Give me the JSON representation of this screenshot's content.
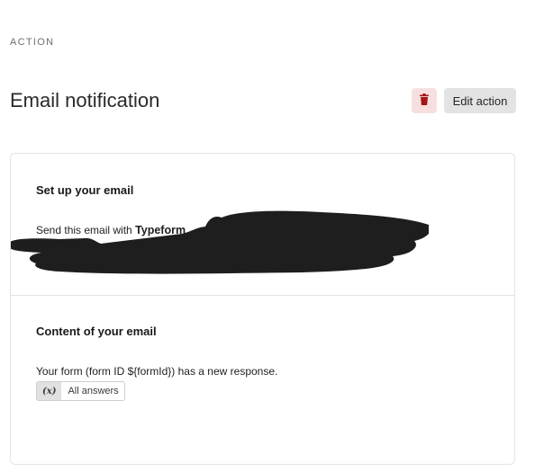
{
  "header": {
    "section_label": "ACTION",
    "title": "Email notification",
    "edit_label": "Edit action",
    "delete_icon": "trash-icon"
  },
  "setup": {
    "heading": "Set up your email",
    "sender_prefix": "Send this email with ",
    "sender_brand": "Typeform"
  },
  "content": {
    "heading": "Content of your email",
    "body": "Your form (form ID ${formId}) has a new response.",
    "variable_icon": "(x)",
    "variable_label": "All answers"
  },
  "colors": {
    "delete_bg": "#f7dfe0",
    "delete_icon": "#a3161a",
    "edit_bg": "#e3e3e3",
    "redaction": "#1e1e1e"
  }
}
